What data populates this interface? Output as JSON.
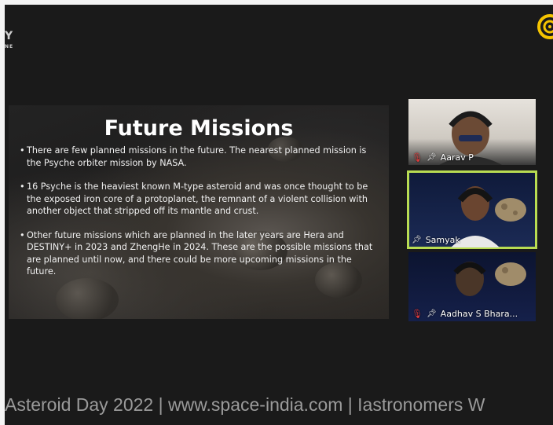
{
  "slide": {
    "title": "Future Missions",
    "bullets": [
      "There are few planned missions in the future. The nearest planned mission is the Psyche orbiter mission by NASA.",
      "16 Psyche is the heaviest known M-type asteroid and was once thought to be the exposed iron core of a protoplanet, the remnant of a violent collision with another object that stripped off its mantle and crust.",
      "Other future missions which are planned in the later years are Hera and DESTINY+ in 2023 and ZhengHe in 2024. These are the possible missions that are planned until now, and there could be more upcoming missions in the future."
    ]
  },
  "participants": [
    {
      "name": "Aarav P",
      "muted": true,
      "active": false
    },
    {
      "name": "Samyak",
      "muted": false,
      "active": true
    },
    {
      "name": "Aadhav S Bhara...",
      "muted": true,
      "active": false
    }
  ],
  "ticker": "Asteroid Day 2022 | www.space-india.com | Iastronomers W",
  "colors": {
    "active_border": "#b8dc52",
    "muted_icon": "#e23b3b",
    "logo": "#f5c400"
  },
  "icons": [
    "muted-mic-icon",
    "pin-icon",
    "logo-icon"
  ]
}
